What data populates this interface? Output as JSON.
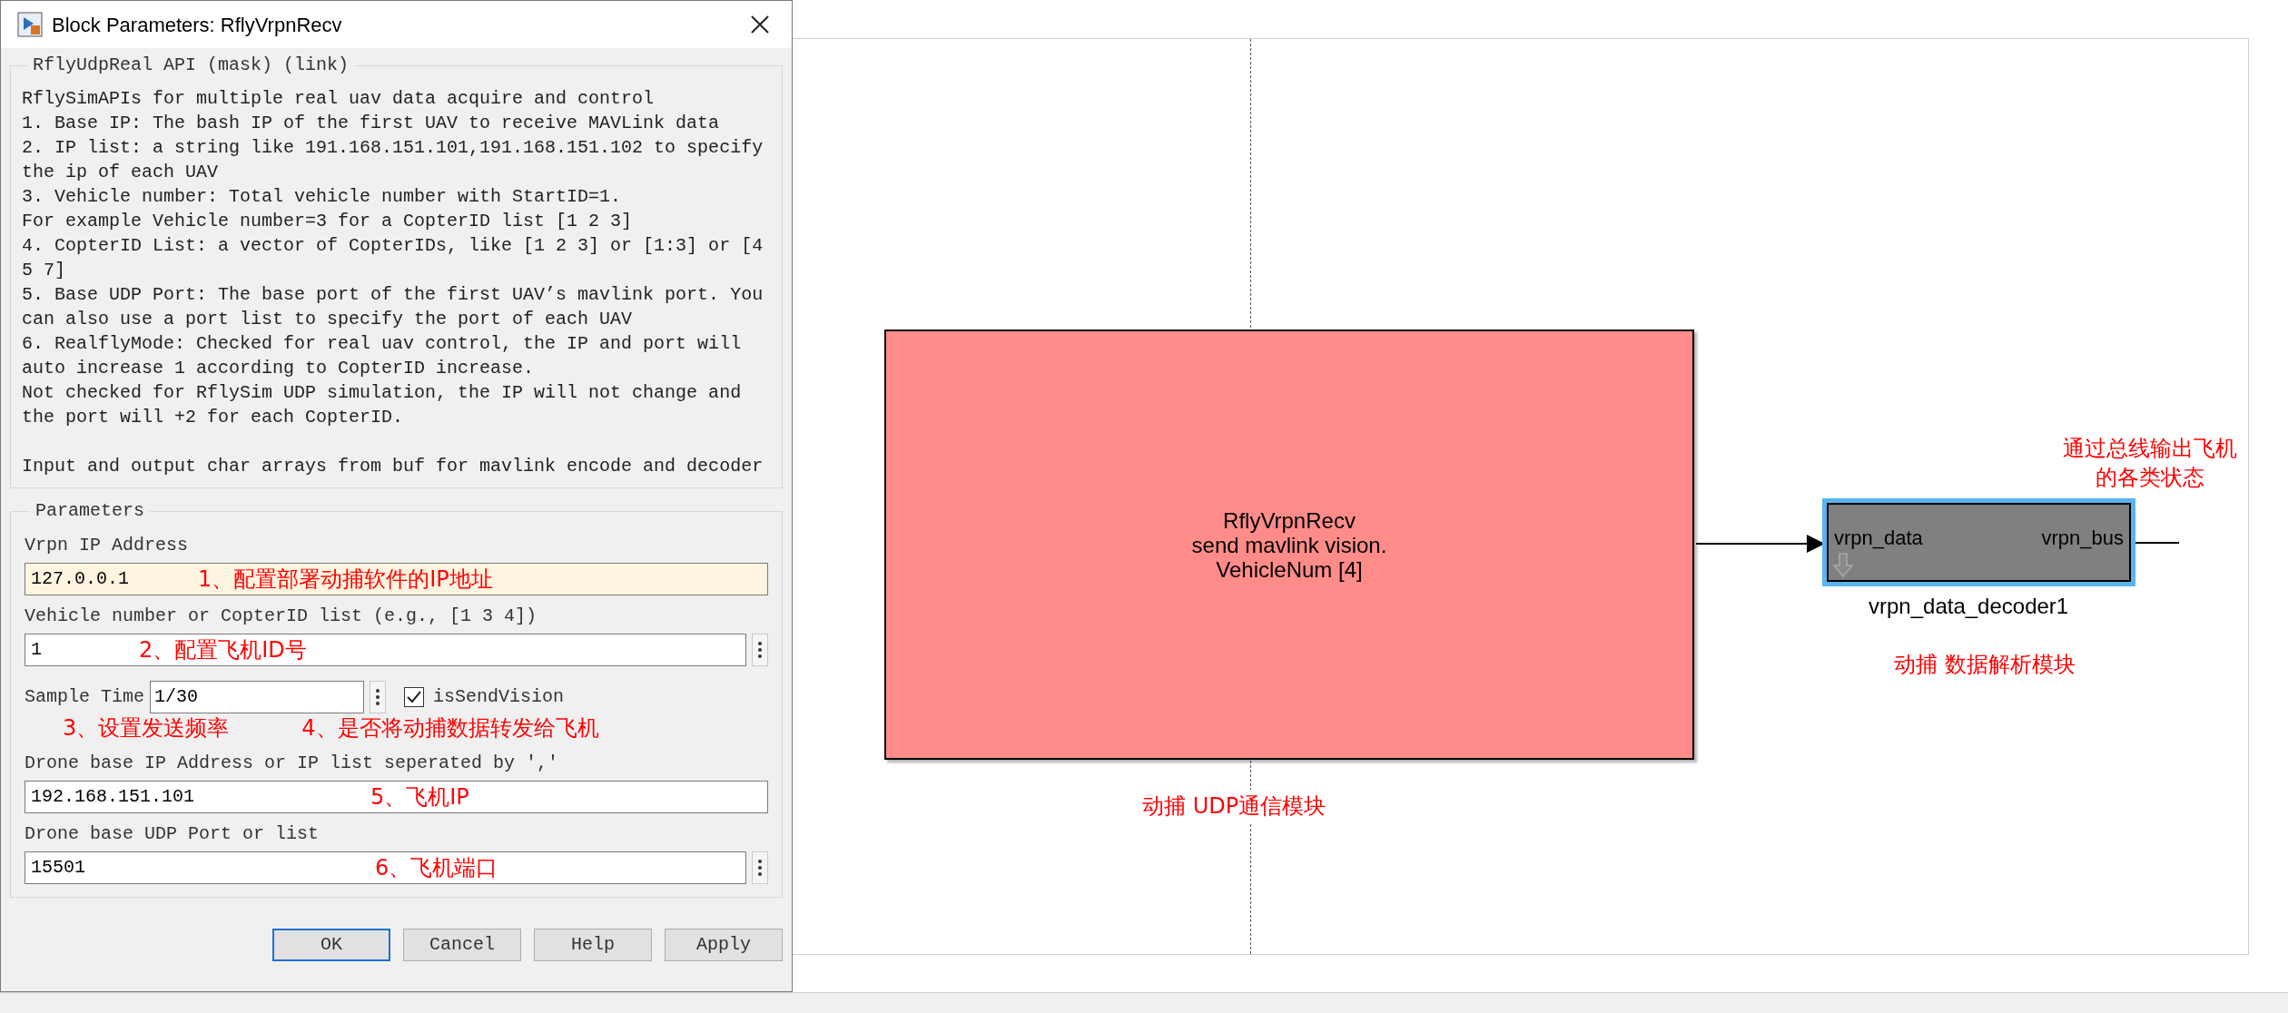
{
  "dialog": {
    "title": "Block Parameters: RflyVrpnRecv",
    "mask_title": "RflyUdpReal API (mask) (link)",
    "description": [
      "RflySimAPIs for multiple real uav data acquire and control",
      "1. Base IP: The bash IP of the first UAV to receive MAVLink data",
      "2. IP list: a string like 191.168.151.101,191.168.151.102 to specify",
      "the ip of each UAV",
      "3. Vehicle number: Total vehicle number with StartID=1.",
      "For example Vehicle number=3 for a CopterID list [1 2 3]",
      "4. CopterID List: a vector of CopterIDs, like [1 2 3] or [1:3] or [4",
      "5 7]",
      "5. Base UDP Port: The base port of the first UAV’s mavlink port. You",
      "can also use a port list to specify the port of each UAV",
      "6. RealflyMode: Checked for real uav control, the IP and port will",
      "auto increase 1 according to CopterID increase.",
      "Not checked for RflySim UDP simulation, the IP will not change and",
      "the port will +2 for each CopterID."
    ],
    "note": "Input and output char arrays from buf for mavlink encode and decoder",
    "parameters_title": "Parameters",
    "parameters": [
      {
        "kind": "field",
        "label": "Vrpn IP Address",
        "value": "127.0.0.1",
        "highlighted": true,
        "menu": false,
        "annotation": "1、配置部署动捕软件的IP地址"
      },
      {
        "kind": "field",
        "label": "Vehicle number or CopterID list (e.g., [1 3 4])",
        "value": "1",
        "highlighted": false,
        "menu": true,
        "annotation": "2、配置飞机ID号"
      },
      {
        "kind": "inline",
        "label": "Sample Time",
        "value": "1/30",
        "menu": true,
        "checkbox": {
          "label": "isSendVision",
          "checked": true
        },
        "annotations": [
          "3、设置发送频率",
          "4、是否将动捕数据转发给飞机"
        ]
      },
      {
        "kind": "field",
        "label": "Drone base IP Address or IP list seperated by ','",
        "value": "192.168.151.101",
        "highlighted": false,
        "menu": false,
        "annotation": "5、飞机IP"
      },
      {
        "kind": "field",
        "label": "Drone base UDP Port or list",
        "value": "15501",
        "highlighted": false,
        "menu": true,
        "annotation": "6、飞机端口"
      }
    ],
    "buttons": [
      {
        "label": "OK",
        "default": true
      },
      {
        "label": "Cancel",
        "default": false
      },
      {
        "label": "Help",
        "default": false
      },
      {
        "label": "Apply",
        "default": false
      }
    ]
  },
  "diagram": {
    "blocks": [
      {
        "kind": "subsystem",
        "lines": [
          "RflyVrpnRecv",
          "send mavlink vision.",
          "VehicleNum [4]"
        ],
        "caption": "动捕 UDP通信模块"
      },
      {
        "kind": "bus",
        "input_port": "vrpn_data",
        "output_port": "vrpn_bus",
        "name": "vrpn_data_decoder1",
        "selected": true,
        "caption": "动捕 数据解析模块",
        "note": [
          "通过总线输出飞机",
          "的各类状态"
        ]
      }
    ]
  }
}
